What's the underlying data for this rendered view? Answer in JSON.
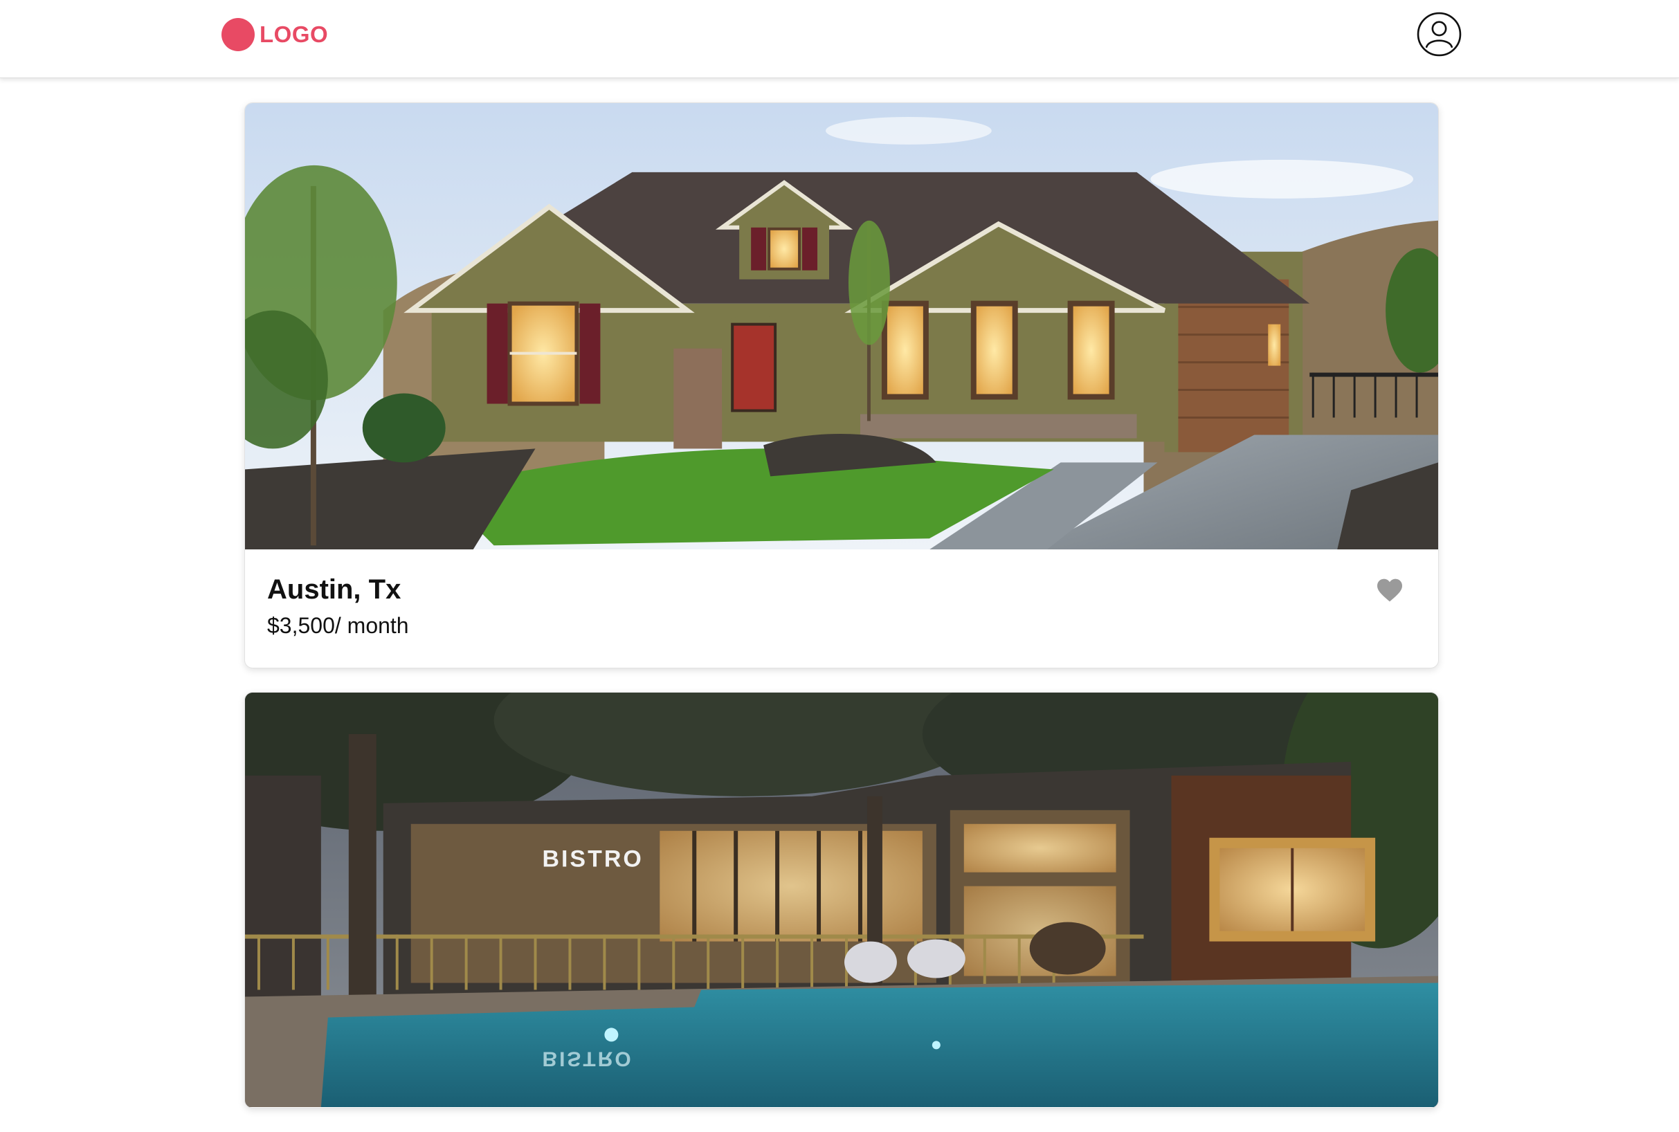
{
  "header": {
    "logo_text": "LOGO",
    "logo_icon": "logo-circle",
    "profile_icon": "user-circle-icon"
  },
  "colors": {
    "brand": "#e84a64",
    "heart_default": "#9a9a9a",
    "text": "#111111",
    "background": "#ffffff"
  },
  "listings": [
    {
      "city": "Austin, Tx",
      "price": "$3,500/ month",
      "favorite_icon": "heart-icon",
      "favorited": false,
      "photo": "house-exterior-photo"
    },
    {
      "city": "",
      "price": "",
      "favorite_icon": "heart-icon",
      "photo": "pool-house-photo",
      "photo_sign_text": "BISTRO"
    }
  ]
}
